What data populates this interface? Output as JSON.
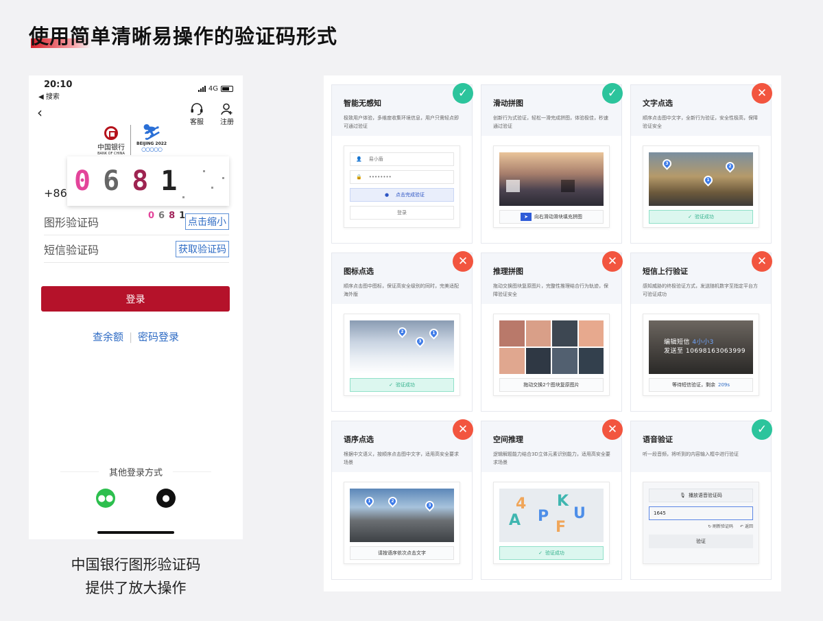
{
  "page_title": "使用简单清晰易操作的验证码形式",
  "phone": {
    "status_time": "20:10",
    "status_back": "◀ 搜索",
    "network": "4G",
    "header_service": "客服",
    "header_register": "注册",
    "boc_name": "中国银行",
    "boc_en": "BANK OF CHINA",
    "beijing_text": "BEIJING 2022",
    "zoom_captcha_chars": [
      "0",
      "6",
      "8",
      "1"
    ],
    "small_captcha_chars": [
      "0",
      "6",
      "8",
      "1"
    ],
    "phone_prefix": "+86",
    "captcha_label": "图形验证码",
    "zoom_out_button": "点击缩小",
    "sms_label": "短信验证码",
    "get_code_button": "获取验证码",
    "login_button": "登录",
    "link_balance": "查余额",
    "link_password_login": "密码登录",
    "other_login": "其他登录方式"
  },
  "caption_lines": [
    "中国银行图形验证码",
    "提供了放大操作"
  ],
  "cards": [
    {
      "title": "智能无感知",
      "desc": "极致用户体验，多维度收集环境信息，用户只需轻点即可通过验证",
      "status": "ok",
      "field_user": "易小盾",
      "field_pass": "••••••••",
      "click_label": "点击完成验证",
      "login_label": "登录"
    },
    {
      "title": "滑动拼图",
      "desc": "创新行为式验证，轻松一滑完成拼图，体验极佳，秒速通过验证",
      "status": "ok",
      "bar": "向右滑动滑块填充拼图"
    },
    {
      "title": "文字点选",
      "desc": "顺序点击图中文字，全新行为验证，安全性极高，保障验证安全",
      "status": "no",
      "bar": "验证成功"
    },
    {
      "title": "图标点选",
      "desc": "顺序点击图中图标，保证高安全级别的同时，完美适配海外版",
      "status": "no",
      "bar": "验证成功"
    },
    {
      "title": "推理拼图",
      "desc": "拖动交换图块复原图片，完整性推理结合行为轨迹，保障验证安全",
      "status": "no",
      "bar": "拖动交换2个图块复原图片"
    },
    {
      "title": "短信上行验证",
      "desc": "感知威胁的终极验证方式，发送随机数字至指定平台方可验证成功",
      "status": "no",
      "sms_line1": "编辑短信",
      "sms_code": "4小小3",
      "sms_line2": "发送至",
      "sms_number": "10698163063999",
      "bar_prefix": "等待短信验证，剩余",
      "bar_count": "209s"
    },
    {
      "title": "语序点选",
      "desc": "根据中文语义，按顺序点击图中文字，适用高安全要求场景",
      "status": "no",
      "bar": "请按语序依次点击文字"
    },
    {
      "title": "空间推理",
      "desc": "逻辑解题能力结合3D立体元素识别能力，适用高安全要求场景",
      "status": "no",
      "letters": [
        "A",
        "P",
        "K",
        "U",
        "F",
        "4"
      ],
      "bar": "验证成功"
    },
    {
      "title": "语音验证",
      "desc": "听一段音频，将听到的内容输入框中进行验证",
      "status": "ok",
      "audio_button": "播放语音验证码",
      "input_value": "1645",
      "refresh": "刷新验证码",
      "back": "返回",
      "verify": "验证"
    }
  ],
  "status_icons": {
    "ok": "✓",
    "no": "✕"
  }
}
